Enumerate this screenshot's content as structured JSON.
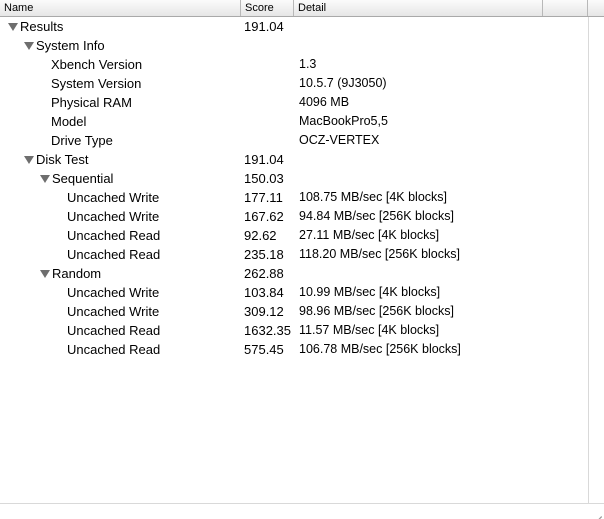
{
  "columns": {
    "name": "Name",
    "score": "Score",
    "detail": "Detail"
  },
  "rows": [
    {
      "name": "Results",
      "score": "191.04",
      "detail": ""
    },
    {
      "name": "System Info",
      "score": "",
      "detail": ""
    },
    {
      "name": "Xbench Version",
      "score": "",
      "detail": "1.3"
    },
    {
      "name": "System Version",
      "score": "",
      "detail": "10.5.7 (9J3050)"
    },
    {
      "name": "Physical RAM",
      "score": "",
      "detail": "4096 MB"
    },
    {
      "name": "Model",
      "score": "",
      "detail": "MacBookPro5,5"
    },
    {
      "name": "Drive Type",
      "score": "",
      "detail": "OCZ-VERTEX"
    },
    {
      "name": "Disk Test",
      "score": "191.04",
      "detail": ""
    },
    {
      "name": "Sequential",
      "score": "150.03",
      "detail": ""
    },
    {
      "name": "Uncached Write",
      "score": "177.11",
      "detail": "108.75 MB/sec [4K blocks]"
    },
    {
      "name": "Uncached Write",
      "score": "167.62",
      "detail": "94.84 MB/sec [256K blocks]"
    },
    {
      "name": "Uncached Read",
      "score": "92.62",
      "detail": "27.11 MB/sec [4K blocks]"
    },
    {
      "name": "Uncached Read",
      "score": "235.18",
      "detail": "118.20 MB/sec [256K blocks]"
    },
    {
      "name": "Random",
      "score": "262.88",
      "detail": ""
    },
    {
      "name": "Uncached Write",
      "score": "103.84",
      "detail": "10.99 MB/sec [4K blocks]"
    },
    {
      "name": "Uncached Write",
      "score": "309.12",
      "detail": "98.96 MB/sec [256K blocks]"
    },
    {
      "name": "Uncached Read",
      "score": "1632.35",
      "detail": "11.57 MB/sec [4K blocks]"
    },
    {
      "name": "Uncached Read",
      "score": "575.45",
      "detail": "106.78 MB/sec [256K blocks]"
    }
  ]
}
